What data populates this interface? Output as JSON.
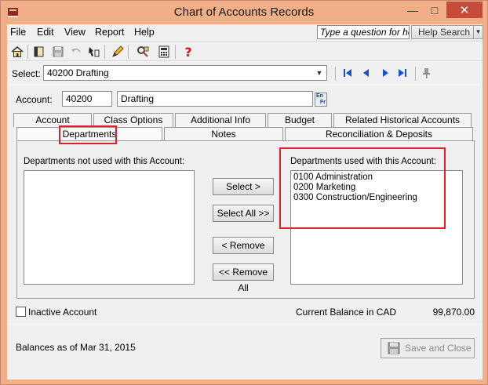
{
  "window": {
    "title": "Chart of Accounts Records"
  },
  "menu": {
    "items": [
      "File",
      "Edit",
      "View",
      "Report",
      "Help"
    ],
    "help_question": "Type a question for help",
    "help_search": "Help Search"
  },
  "toolbar": {
    "icons": [
      "home-icon",
      "records-icon",
      "save-icon",
      "undo-icon",
      "find-icon",
      "pencil-icon",
      "settings-icon",
      "calculator-icon",
      "help-icon"
    ]
  },
  "select": {
    "label": "Select:",
    "value": "40200 Drafting"
  },
  "account": {
    "label": "Account:",
    "number": "40200",
    "name": "Drafting",
    "lang_top": "En",
    "lang_bottom": "Fr"
  },
  "tabs": {
    "row_back": [
      "Account",
      "Class Options",
      "Additional Info",
      "Budget",
      "Related Historical Accounts"
    ],
    "row_front": [
      "Departments",
      "Notes",
      "Reconciliation & Deposits"
    ]
  },
  "departments": {
    "not_used_label": "Departments not used with this Account:",
    "used_label": "Departments used with this Account:",
    "not_used": [],
    "used": [
      "0100 Administration",
      "0200 Marketing",
      "0300 Construction/Engineering"
    ]
  },
  "buttons": {
    "select": "Select >",
    "select_all": "Select All >>",
    "remove": "< Remove",
    "remove_all": "<< Remove All",
    "save_close": "Save and Close"
  },
  "footer": {
    "inactive_label": "Inactive Account",
    "inactive_checked": false,
    "balance_label": "Current Balance in  CAD",
    "balance_value": "99,870.00",
    "balances_as_of": "Balances as of Mar 31, 2015"
  },
  "colors": {
    "frame": "#f0ae89",
    "highlight": "#e0202a",
    "close_button": "#c74c3c",
    "nav_arrow": "#1a4fd0"
  }
}
